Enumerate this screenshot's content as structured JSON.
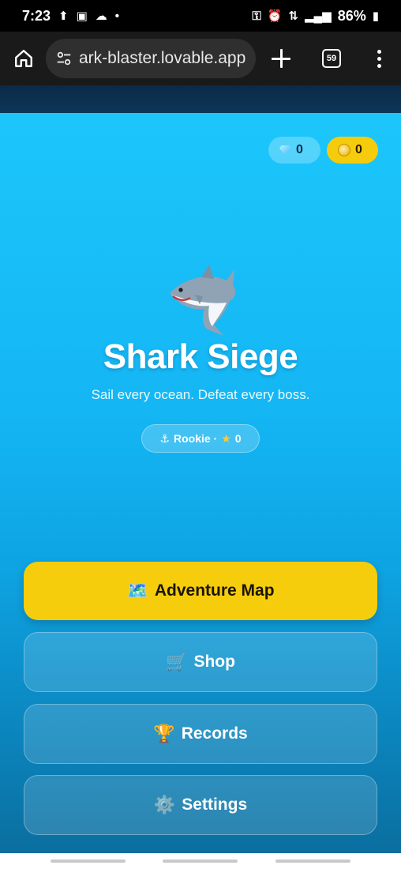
{
  "status_bar": {
    "time": "7:23",
    "battery": "86%"
  },
  "browser": {
    "url": "ark-blaster.lovable.app",
    "tab_count": "59"
  },
  "currency": {
    "gems": "0",
    "coins": "0"
  },
  "hero": {
    "title": "Shark Siege",
    "subtitle": "Sail every ocean. Defeat every boss.",
    "rank": "Rookie · ",
    "stars": "0"
  },
  "menu": {
    "adventure_label": "Adventure Map",
    "adventure_icon": "🗺️",
    "shop_label": "Shop",
    "shop_icon": "🛒",
    "records_label": "Records",
    "records_icon": "🏆",
    "settings_label": "Settings",
    "settings_icon": "⚙️"
  },
  "colors": {
    "primary_button": "#f5cd0d",
    "sky_top": "#1cc6fb",
    "sky_bottom": "#0b6e9f"
  }
}
